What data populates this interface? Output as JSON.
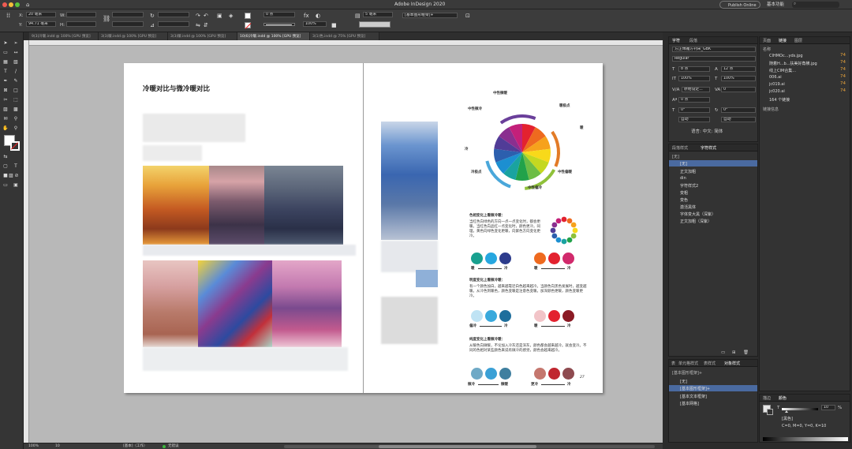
{
  "app": {
    "title": "Adobe InDesign 2020",
    "publish_label": "Publish Online",
    "workspace_label": "基本功能"
  },
  "control": {
    "x_label": "X:",
    "y_label": "Y:",
    "w_label": "W:",
    "h_label": "H:",
    "x_value": "20 毫米",
    "y_value": "94.71 毫米",
    "stroke_weight": "0 点",
    "scale_value": "100%",
    "offset_value": "5 毫米",
    "object_style": "[基本图形框架]+"
  },
  "tabs": [
    {
      "label": "9(3)冷暖.indd @ 100% [GPU 预览]"
    },
    {
      "label": "3(3)暖.indd @ 100% [GPU 预览]"
    },
    {
      "label": "3(3)暖.indd @ 100% [GPU 预览]"
    },
    {
      "label": "10(6)冷暖.indd @ 100% [GPU 预览]"
    },
    {
      "label": "3(1)色.indd @ 75% [GPU 预览]"
    }
  ],
  "document": {
    "heading": "冷暖对比与微冷暖对比",
    "wheel_labels": {
      "top": "中性微暖",
      "top_left": "中性微冷",
      "right_top": "暖极点",
      "right": "暖",
      "left": "冷",
      "left_bottom": "冷极点",
      "bottom_right": "中性偏暖",
      "bottom": "中性偏冷"
    },
    "section1_title": "色相变化上看微冷暖：",
    "section1_body": "当红色向绿色的方向一点一点变化时，都会更暖。当红色向品红一点变化时，颜色更冷。同理，黄色向绿色变化更暖，向紫色方向变化更冷。",
    "arrow1_left": "暖",
    "arrow1_right": "冷",
    "arrow2_left": "暖",
    "arrow2_right": "冷",
    "section2_title": "明度变化上看微冷暖：",
    "section2_body": "有一个颜色加白，越来越靠近白色越来越冷。当颜色向黑色发展时，越变越暖。从冷色到暖色，颜色变暖是注意色变暖。加深颜色更暖，颜色变暖更冷。",
    "arrow3_left": "偏冷",
    "arrow3_right": "冷",
    "arrow4_left": "暖",
    "arrow4_right": "冷",
    "section3_title": "纯度变化上看微冷暖：",
    "section3_body": "从暖色向微暖，不论加入冷灰还是深灰，颜色都会越来越冷。就会变冷。不同的色相对某些颜色来说有微冷的感觉，颜色会越来越冷。",
    "arrow5_left": "微冷",
    "arrow5_right": "微暖",
    "arrow6_left": "更冷",
    "arrow6_right": "冷",
    "page_number": "27"
  },
  "colors": {
    "wheel": [
      "#e3222f",
      "#ee6a1f",
      "#f6a21c",
      "#f8d91a",
      "#c4d820",
      "#6cbd45",
      "#22a24a",
      "#1aa3a0",
      "#1c8fd1",
      "#2c5fae",
      "#513c97",
      "#8a2f8f",
      "#c3207a"
    ],
    "ring": [
      "#6a3f9a",
      "#e27b27",
      "#8fc13a",
      "#4aa7da"
    ],
    "row1": [
      "#18a08f",
      "#27a7e0",
      "#2d3c8c",
      "#ee6a1f",
      "#e3222f",
      "#d12a6c"
    ],
    "row2": [
      "#bfe3f4",
      "#39a9dc",
      "#1e6e9c",
      "#f2c4c8",
      "#e3222f",
      "#8b1a24"
    ],
    "row3": [
      "#6fa9c6",
      "#3aa0d6",
      "#3f7f9f",
      "#c5776e",
      "#c0262f",
      "#8e4a4f"
    ],
    "small_wheel": [
      "#e3222f",
      "#ee6a1f",
      "#f6a21c",
      "#f8d91a",
      "#8fc13a",
      "#22a24a",
      "#1aa3a0",
      "#1c8fd1",
      "#2c5fae",
      "#513c97",
      "#8a2f8f",
      "#c3207a"
    ]
  },
  "char_panel": {
    "tabs": [
      "字符",
      "段落"
    ],
    "font": "方正博雅方刊宋_GBK",
    "style": "Regular",
    "size": "8 点",
    "leading": "12 点",
    "vscale": "100%",
    "hscale": "100%",
    "kerning": "原始设定...",
    "tracking": "0",
    "baseline": "0 点",
    "skew": "0°",
    "rotate": "0°",
    "auto1": "自动",
    "auto2": "自动",
    "lang": "语言: 中文: 简体"
  },
  "char_style_panel": {
    "tabs": [
      "段落样式",
      "字符样式"
    ],
    "items": [
      "[无]",
      "[无]",
      "正文加粗",
      "din",
      "字符样式2",
      "变粗",
      "变色",
      "激活黑体",
      "字体变大黑（深紫）",
      "正文加粗（深紫）"
    ]
  },
  "object_style_panel": {
    "tabs": [
      "表",
      "单元格样式",
      "表样式",
      "对象样式"
    ],
    "header": "[基本图形框架]+",
    "items": [
      "[无]",
      "[基本图形框架]+",
      "[基本文本框架]",
      "[基本网格]"
    ]
  },
  "links_panel": {
    "tabs": [
      "页面",
      "链接",
      "图层"
    ],
    "header": "名称",
    "items": [
      "CIHMOc...yds.jpg",
      "随着H...b...扶美好角横.jpg",
      "线上CIM合集...",
      "006.ai",
      "jc019.ai",
      "jc020.ai"
    ],
    "count": "164 个链接",
    "info": "链接信息"
  },
  "color_panel": {
    "tabs": [
      "描边",
      "颜色"
    ],
    "tint_label": "T",
    "tint_value": "10",
    "tint_unit": "%",
    "swatch_name": "[黑色]",
    "cmyk": "C=0, M=0, Y=0, K=10"
  },
  "status": {
    "zoom": "100%",
    "page": "10",
    "style": "[基本]（工作）",
    "preflight": "无错误"
  }
}
